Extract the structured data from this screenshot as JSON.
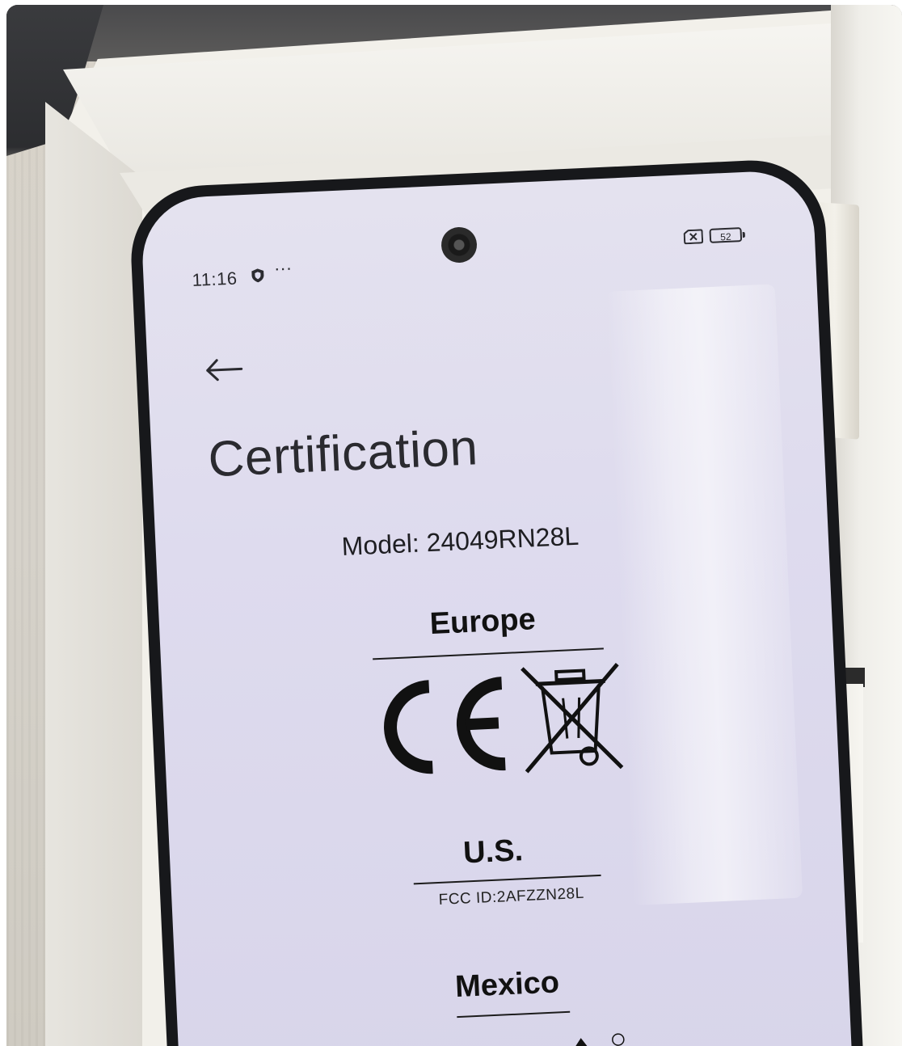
{
  "status_bar": {
    "time": "11:16",
    "dots": "···",
    "battery_level": "52"
  },
  "page": {
    "title": "Certification",
    "model": "Model: 24049RN28L"
  },
  "sections": {
    "europe": {
      "title": "Europe"
    },
    "us": {
      "title": "U.S.",
      "fcc_id": "FCC ID:2AFZZN28L"
    },
    "mexico": {
      "title": "Mexico"
    }
  },
  "icons": {
    "back": "back-arrow-icon",
    "ce": "ce-mark-icon",
    "weee": "crossed-bin-icon",
    "shield": "shield-icon",
    "sim": "no-sim-icon",
    "battery": "battery-icon",
    "ifetel": "ifetel-logo-icon"
  },
  "colors": {
    "screen_bg": "#dedbee",
    "text": "#1e1e22",
    "phone_frame": "#17181b",
    "box": "#f2f0ea"
  }
}
